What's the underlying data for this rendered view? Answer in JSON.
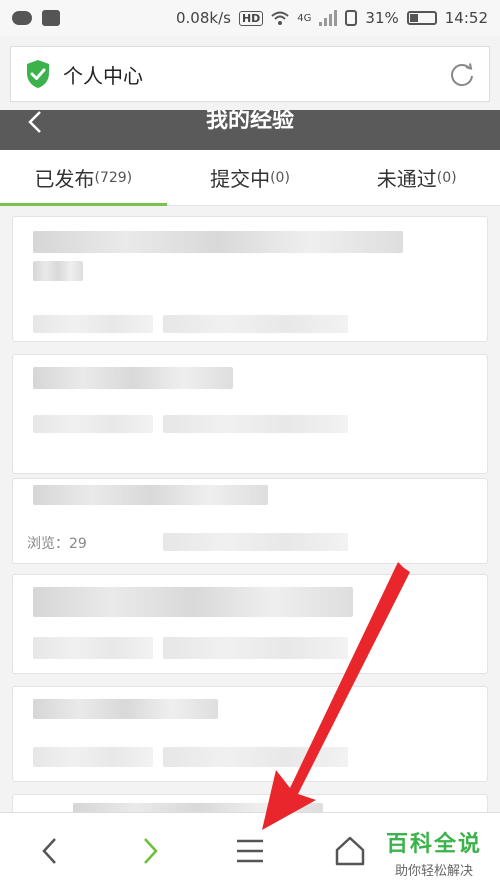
{
  "status_bar": {
    "speed": "0.08k/s",
    "network": "4G",
    "battery": "31%",
    "time": "14:52"
  },
  "title_bar": {
    "title": "个人中心"
  },
  "header": {
    "title": "我的经验"
  },
  "tabs": [
    {
      "label": "已发布",
      "count": "(729)",
      "active": true
    },
    {
      "label": "提交中",
      "count": "(0)",
      "active": false
    },
    {
      "label": "未通过",
      "count": "(0)",
      "active": false
    }
  ],
  "list": {
    "item3_views": "浏览：29"
  },
  "bottom_nav": {
    "brand_name": "百科全说",
    "brand_sub": "助你轻松解决"
  },
  "colors": {
    "accent": "#7dc24a",
    "header": "#5a5a5a",
    "arrow": "#e8262b",
    "brand": "#3bb34a"
  }
}
